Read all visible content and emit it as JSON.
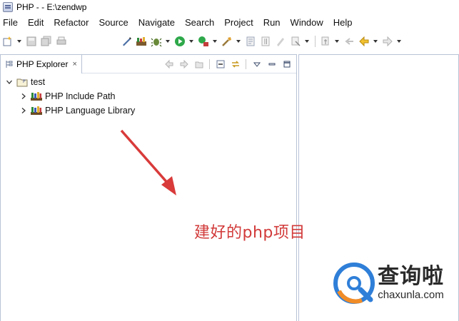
{
  "window": {
    "title": "PHP -  - E:\\zendwp"
  },
  "menubar": {
    "items": [
      "File",
      "Edit",
      "Refactor",
      "Source",
      "Navigate",
      "Search",
      "Project",
      "Run",
      "Window",
      "Help"
    ]
  },
  "explorer": {
    "tab_label": "PHP Explorer",
    "tab_close": "×",
    "tree": [
      {
        "label": "test",
        "expanded": true,
        "level": 0,
        "icon": "php-project-icon"
      },
      {
        "label": "PHP Include Path",
        "expanded": false,
        "level": 1,
        "icon": "library-icon"
      },
      {
        "label": "PHP Language Library",
        "expanded": false,
        "level": 1,
        "icon": "library-icon"
      }
    ]
  },
  "annotation": {
    "text": "建好的php项目",
    "color": "#d23a3a"
  },
  "watermark": {
    "title": "查询啦",
    "domain": "chaxunla.com"
  },
  "colors": {
    "accent_blue": "#2f7fd8",
    "accent_orange": "#f08c28",
    "arrow_red": "#d93a3a"
  }
}
